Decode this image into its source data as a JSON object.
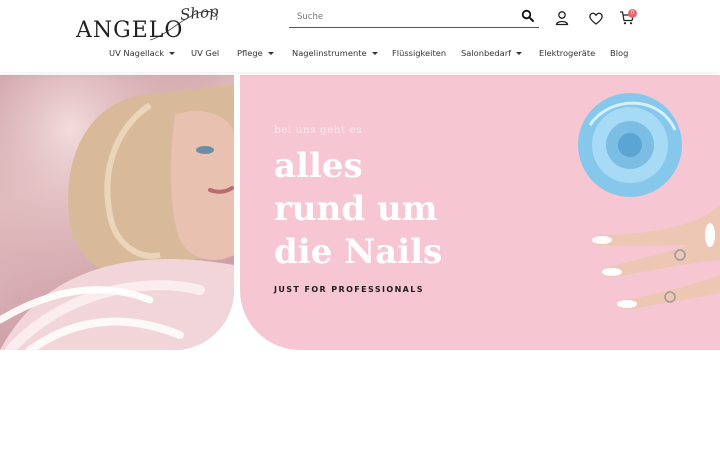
{
  "brand": {
    "logo_main": "ANGELO",
    "logo_script": "Shop"
  },
  "search": {
    "placeholder": "Suche"
  },
  "cart": {
    "count": "0"
  },
  "nav": {
    "items": [
      {
        "label": "UV Nagellack"
      },
      {
        "label": "UV Gel"
      },
      {
        "label": "Pflege"
      },
      {
        "label": "Nagelinstrumente"
      },
      {
        "label": "Flüssigkeiten"
      },
      {
        "label": "Salonbedarf"
      },
      {
        "label": "Elektrogeräte"
      },
      {
        "label": "Blog"
      }
    ]
  },
  "hero": {
    "kicker": "bei uns geht es",
    "title_lines": [
      "alles",
      "rund um",
      "die Nails"
    ],
    "subtitle": "JUST FOR PROFESSIONALS"
  },
  "colors": {
    "hero_pink": "#f7c6d3",
    "accent_blue": "#7cc3ea",
    "badge": "#e26a6a"
  }
}
